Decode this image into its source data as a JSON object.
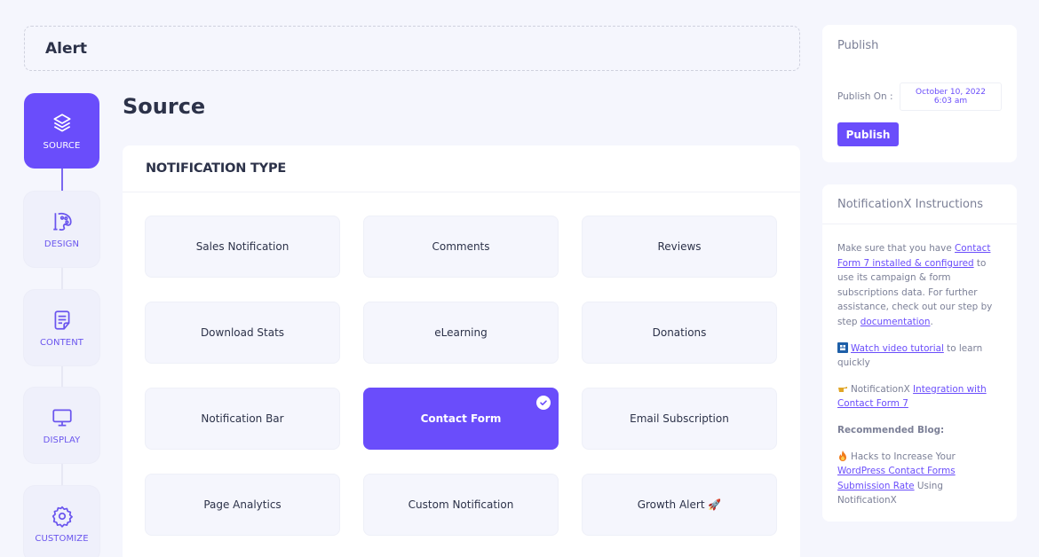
{
  "header": {
    "title": "Alert"
  },
  "steps": [
    {
      "label": "SOURCE",
      "icon": "layers-icon",
      "active": true
    },
    {
      "label": "DESIGN",
      "icon": "palette-icon",
      "active": false
    },
    {
      "label": "CONTENT",
      "icon": "document-icon",
      "active": false
    },
    {
      "label": "DISPLAY",
      "icon": "monitor-icon",
      "active": false
    },
    {
      "label": "CUSTOMIZE",
      "icon": "gear-icon",
      "active": false
    }
  ],
  "main": {
    "page_title": "Source",
    "section_title": "NOTIFICATION TYPE",
    "selected": "Contact Form",
    "types": [
      {
        "label": "Sales Notification"
      },
      {
        "label": "Comments"
      },
      {
        "label": "Reviews"
      },
      {
        "label": "Download Stats"
      },
      {
        "label": "eLearning"
      },
      {
        "label": "Donations"
      },
      {
        "label": "Notification Bar"
      },
      {
        "label": "Contact Form"
      },
      {
        "label": "Email Subscription"
      },
      {
        "label": "Page Analytics"
      },
      {
        "label": "Custom Notification"
      },
      {
        "label": "Growth Alert 🚀"
      }
    ]
  },
  "publish": {
    "title": "Publish",
    "publish_on_label": "Publish On :",
    "date_line1": "October 10, 2022",
    "date_line2": "6:03 am",
    "button_label": "Publish"
  },
  "instructions": {
    "title": "NotificationX Instructions",
    "p1_pre": "Make sure that you have ",
    "p1_link": "Contact Form 7 installed & configured",
    "p1_mid": " to use its campaign & form subscriptions data. For further assistance, check out our step by step ",
    "p1_link2": "documentation",
    "p1_end": ".",
    "p2_link": "Watch video tutorial",
    "p2_end": " to learn quickly",
    "p3_pre": "NotificationX ",
    "p3_link": "Integration with Contact Form 7",
    "p4": "Recommended Blog:",
    "p5_pre": "Hacks to Increase Your ",
    "p5_link": "WordPress Contact Forms Submission Rate",
    "p5_end": " Using NotificationX"
  },
  "colors": {
    "accent": "#6a4dfb",
    "background": "#f5f6fd",
    "text": "#2c3249",
    "muted": "#7c8097"
  }
}
